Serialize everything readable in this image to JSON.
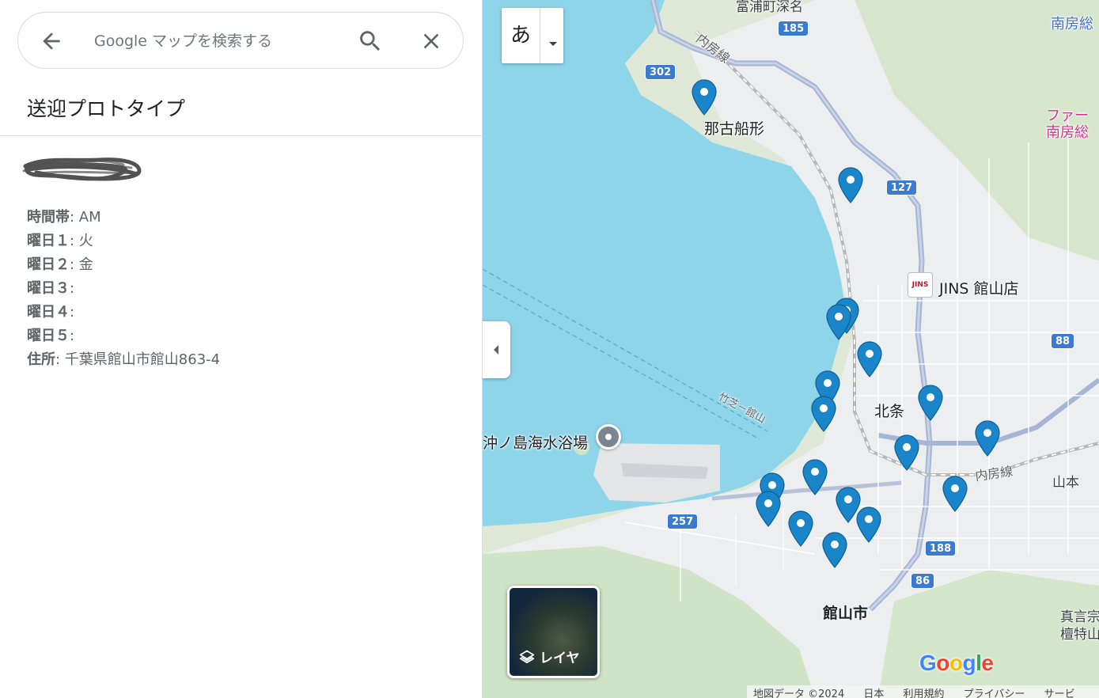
{
  "search": {
    "placeholder": "Google マップを検索する"
  },
  "panel": {
    "title": "送迎プロトタイプ",
    "fields": [
      {
        "label": "時間帯",
        "value": ": AM"
      },
      {
        "label": "曜日１",
        "value": ": 火"
      },
      {
        "label": "曜日２",
        "value": ": 金"
      },
      {
        "label": "曜日３",
        "value": ":"
      },
      {
        "label": "曜日４",
        "value": ":"
      },
      {
        "label": "曜日５",
        "value": ":"
      },
      {
        "label": "住所",
        "value": ": 千葉県館山市館山863-4"
      }
    ]
  },
  "map": {
    "language_button": "あ",
    "layer_button": "レイヤ",
    "labels": {
      "tomiura": "富浦町深名",
      "nago_funagata": "那古船形",
      "jins": "JINS 館山店",
      "jins_logo": "JINS",
      "hojo": "北条",
      "tateyama": "館山市",
      "okinoshima": "沖ノ島海水浴場",
      "uchibo_north": "内房線",
      "uchibo_south": "内房線",
      "ferry": "竹芝－館山",
      "yamamoto": "山本",
      "minamiboso_top": "南房総",
      "minamiboso_pink1": "ファー",
      "minamiboso_pink2": "南房総",
      "shingon1": "真言宗",
      "shingon2": "檀特山"
    },
    "routes": [
      "185",
      "302",
      "127",
      "88",
      "257",
      "188",
      "86"
    ],
    "pin_count": 19
  },
  "footer": {
    "logo": "Google",
    "items": [
      "地図データ ©2024",
      "日本",
      "利用規約",
      "プライバシー",
      "サービ"
    ]
  }
}
